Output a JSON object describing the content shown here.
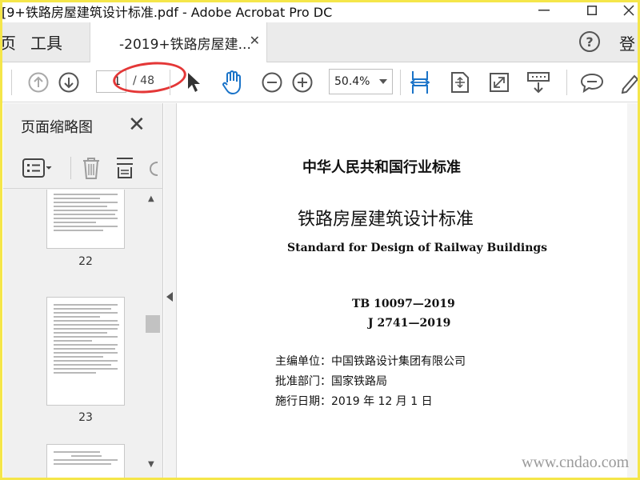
{
  "window": {
    "title": "[9+铁路房屋建筑设计标准.pdf - Adobe Acrobat Pro DC"
  },
  "tabbar": {
    "home_label": "页",
    "tools_label": "工具",
    "doc_tab_label": "-2019+铁路房屋建...",
    "login_label": "登"
  },
  "toolbar": {
    "current_page": "1",
    "total_pages": "/ 48",
    "zoom": "50.4%"
  },
  "panel": {
    "title": "页面缩略图",
    "thumbnails": [
      {
        "page": "22"
      },
      {
        "page": "23"
      }
    ]
  },
  "document": {
    "heading_1": "中华人民共和国行业标准",
    "heading_2": "铁路房屋建筑设计标准",
    "english_title": "Standard for Design of Railway Buildings",
    "code_1": "TB 10097—2019",
    "code_2": "J 2741—2019",
    "editor_unit": "主编单位：中国铁路设计集团有限公司",
    "approval_dept": "批准部门：国家铁路局",
    "effective_date": "施行日期：2019 年 12 月 1 日"
  },
  "watermark": "www.cndao.com",
  "colors": {
    "accent_blue": "#1a73c8",
    "annotation_red": "#e43737",
    "frame_yellow": "#f5e64a"
  }
}
